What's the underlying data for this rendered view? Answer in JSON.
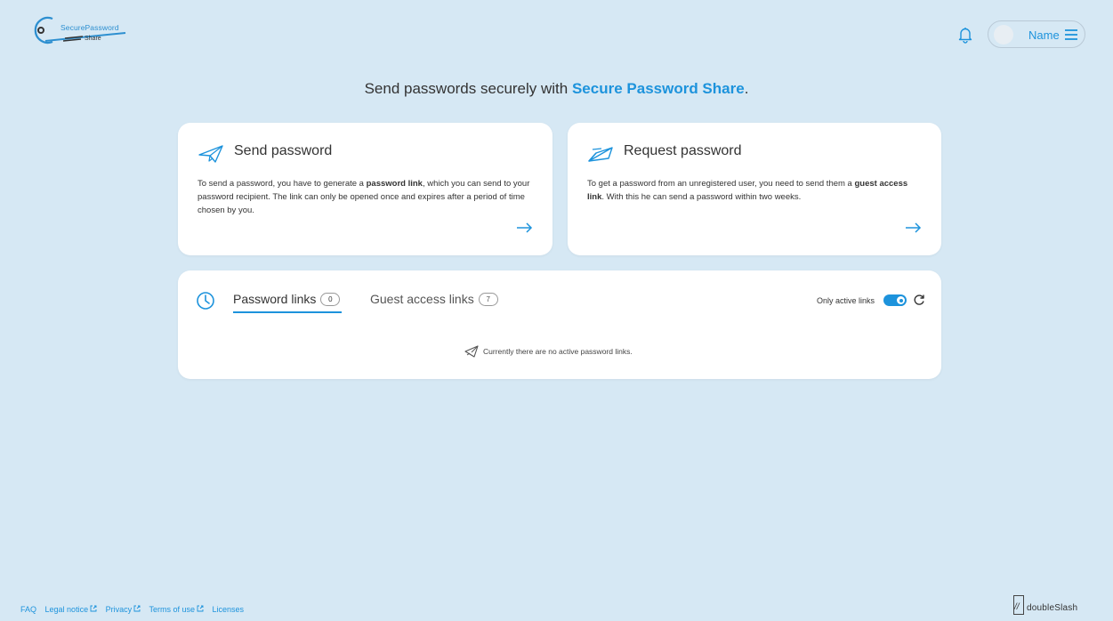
{
  "app": {
    "logo_top": "SecurePassword",
    "logo_bottom": "Share"
  },
  "header": {
    "user_name": "Name",
    "icons": {
      "notifications": "bell-icon",
      "menu": "hamburger-menu-icon"
    }
  },
  "headline": {
    "prefix": "Send passwords securely with ",
    "brand": "Secure Password Share",
    "suffix": "."
  },
  "send_card": {
    "title": "Send password",
    "body_1": "To send a password, you have to generate a ",
    "body_bold": "password link",
    "body_2": ", which you can send to your password recipient. The link can only be opened once and expires after a period of time chosen by you.",
    "icon": "paper-plane-icon"
  },
  "request_card": {
    "title": "Request password",
    "body_1": "To get a password from an unregistered user, you need to send them a ",
    "body_bold": "guest access link",
    "body_2": ". With this he can send a password within two weeks.",
    "icon": "paper-plane-request-icon"
  },
  "links_panel": {
    "tabs": [
      {
        "label": "Password links",
        "count": "0",
        "active": true
      },
      {
        "label": "Guest access links",
        "count": "7",
        "active": false
      }
    ],
    "only_active_label": "Only active links",
    "only_active_on": true,
    "empty_message": "Currently there are no active password links."
  },
  "footer": {
    "links": [
      {
        "label": "FAQ",
        "external": false
      },
      {
        "label": "Legal notice",
        "external": true
      },
      {
        "label": "Privacy",
        "external": true
      },
      {
        "label": "Terms of use",
        "external": true
      },
      {
        "label": "Licenses",
        "external": false
      }
    ],
    "vendor_slashes": "//",
    "vendor": "doubleSlash"
  },
  "colors": {
    "background": "#d6e8f4",
    "accent": "#1d93dc",
    "card": "#ffffff"
  }
}
